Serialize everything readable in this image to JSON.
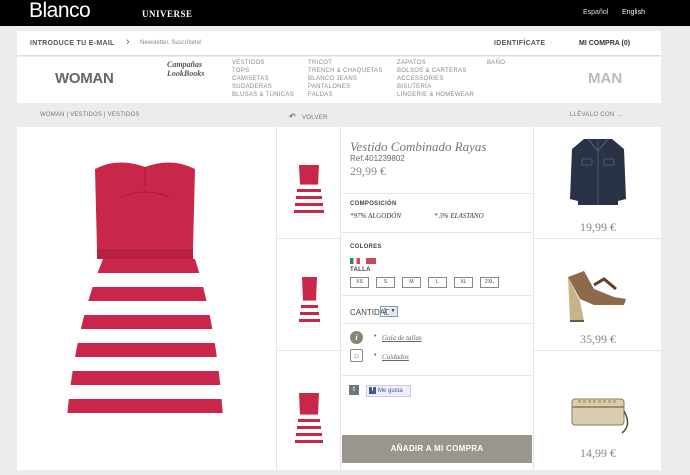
{
  "header": {
    "logo": "Blanco",
    "universe": "UNIVERSE",
    "lang_es": "Español",
    "lang_en": "English"
  },
  "account_bar": {
    "email_label": "INTRODUCE TU E-MAIL",
    "newsletter": "Newsletter. Suscríbete!",
    "identify": "IDENTIFÍCATE",
    "separator": "·",
    "cart": "MI COMPRA (0)"
  },
  "nav": {
    "woman": "WOMAN",
    "man": "MAN",
    "campaigns_1": "Campañas",
    "campaigns_2": "LookBooks",
    "col1": [
      "VESTIDOS",
      "TOPS",
      "CAMISETAS",
      "SUDADERAS",
      "BLUSAS & TÚNICAS"
    ],
    "col2": [
      "TRICOT",
      "TRENCH & CHAQUETAS",
      "BLANCO JEANS",
      "PANTALONES",
      "FALDAS"
    ],
    "col3": [
      "ZAPATOS",
      "BOLSOS & CARTERAS",
      "ACCESSORIES",
      "BISUTERÍA",
      "LINGERIE & HOMEWEAR"
    ],
    "col4": [
      "BAÑO"
    ]
  },
  "breadcrumb": "WOMAN | VESTIDOS | VESTIDOS",
  "back_label": "VOLVER",
  "take_it_with": "LLÉVALO CON ...",
  "product": {
    "title": "Vestido Combinado Rayas",
    "ref": "Ref.401239802",
    "price": "29,99 €",
    "composition_label": "COMPOSICIÓN",
    "composition_1": "*97% ALGODÓN",
    "composition_2": "* 3% ELASTANO",
    "colors_label": "COLORES",
    "colors": [
      "#2f8a5a",
      "#c94a5e"
    ],
    "size_label": "TALLA",
    "sizes": [
      "XS",
      "S",
      "M",
      "L",
      "XL",
      "2XL"
    ],
    "quantity_label": "CANTIDAD",
    "quantity": "1",
    "size_guide": "Guía de tallas",
    "care": "Cuidados",
    "like": "Me gusta",
    "add_to_cart": "AÑADIR A MI COMPRA"
  },
  "related": [
    {
      "price": "19,99 €",
      "icon": "denim-jacket-icon"
    },
    {
      "price": "35,99 €",
      "icon": "wedge-sandal-icon"
    },
    {
      "price": "14,99 €",
      "icon": "clutch-bag-icon"
    }
  ],
  "colors": {
    "dress_red": "#c8274a",
    "stripe_white": "#ffffff",
    "button_gray": "#9a968e"
  }
}
